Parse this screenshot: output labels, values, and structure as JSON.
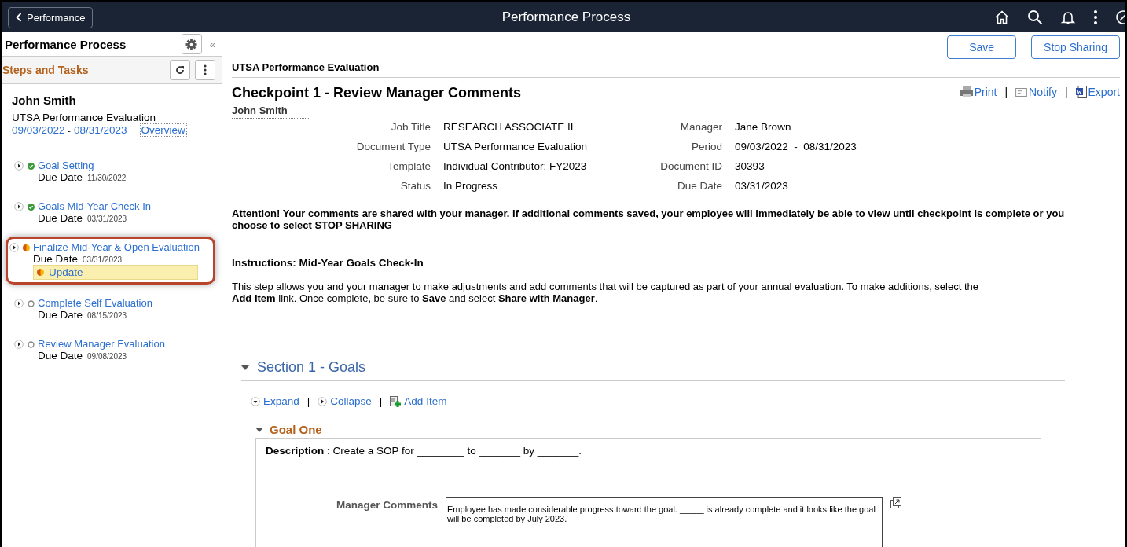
{
  "header": {
    "back_label": "Performance",
    "title": "Performance Process"
  },
  "sidebar": {
    "title": "Performance Process",
    "collapse_glyph": "«",
    "subtitle": "Steps and Tasks",
    "person": {
      "name": "John Smith",
      "document": "UTSA Performance Evaluation",
      "start": "09/03/2022",
      "separator": "-",
      "end": "08/31/2023",
      "link": "Overview"
    },
    "steps": [
      {
        "title": "Goal Setting",
        "kind": "complete",
        "selected": false,
        "due_label": "Due Date",
        "due": "11/30/2022"
      },
      {
        "title": "Goals Mid-Year Check In",
        "kind": "complete",
        "selected": false,
        "due_label": "Due Date",
        "due": "03/31/2023"
      },
      {
        "title": "Finalize Mid-Year & Open Evaluation",
        "kind": "in_progress",
        "selected": true,
        "due_label": "Due Date",
        "due": "03/31/2023",
        "subtask": {
          "label": "Update",
          "kind": "in_progress"
        }
      },
      {
        "title": "Complete Self Evaluation",
        "kind": "not_started",
        "selected": false,
        "due_label": "Due Date",
        "due": "08/15/2023"
      },
      {
        "title": "Review Manager Evaluation",
        "kind": "not_started",
        "selected": false,
        "due_label": "Due Date",
        "due": "09/08/2023"
      }
    ]
  },
  "toolbar": {
    "buttons": [
      "Save",
      "Stop Sharing"
    ]
  },
  "document": {
    "heading": "UTSA Performance Evaluation",
    "title": "Checkpoint 1 - Review Manager Comments",
    "actions": [
      "Print",
      "Notify",
      "Export"
    ],
    "action_separators": [
      "|",
      "|"
    ],
    "employee": "John Smith",
    "details": [
      {
        "label": "Job Title",
        "value": "RESEARCH ASSOCIATE II"
      },
      {
        "label": "Manager",
        "value": "Jane Brown"
      },
      {
        "label": "Document Type",
        "value": "UTSA Performance Evaluation"
      },
      {
        "label": "Period",
        "value": "09/03/2022  -  08/31/2023"
      },
      {
        "label": "Template",
        "value": "Individual Contributor: FY2023"
      },
      {
        "label": "Document ID",
        "value": "30393"
      },
      {
        "label": "Status",
        "value": "In Progress"
      },
      {
        "label": "Due Date",
        "value": "03/31/2023"
      }
    ],
    "attention": "Attention! Your comments are shared with your manager. If additional comments saved, your employee will immediately be able to view until checkpoint is complete or you choose to select STOP SHARING",
    "instructions": {
      "title": "Instructions: Mid-Year Goals Check-In",
      "text_before": "This step allows you and your manager to make adjustments and add comments that will be captured as part of your annual evaluation. To make additions, select the",
      "link": "Add Item",
      "text_after": " link. Once complete, be sure to **Save** and select **Share with Manager**."
    },
    "section": {
      "title": "Section 1 - Goals",
      "expanded": true,
      "links": [
        "Expand",
        "Collapse",
        "Add Item"
      ],
      "link_separators": [
        "|",
        "|"
      ],
      "goal": {
        "title": "Goal One",
        "expanded": true,
        "description": "**Description** : Create a SOP for ________ to _______ by _______.",
        "comments_label": "Manager Comments",
        "comments": "Employee has made considerable progress toward the goal. _____ is already complete and it looks like the goal will be completed by July 2023."
      }
    }
  }
}
